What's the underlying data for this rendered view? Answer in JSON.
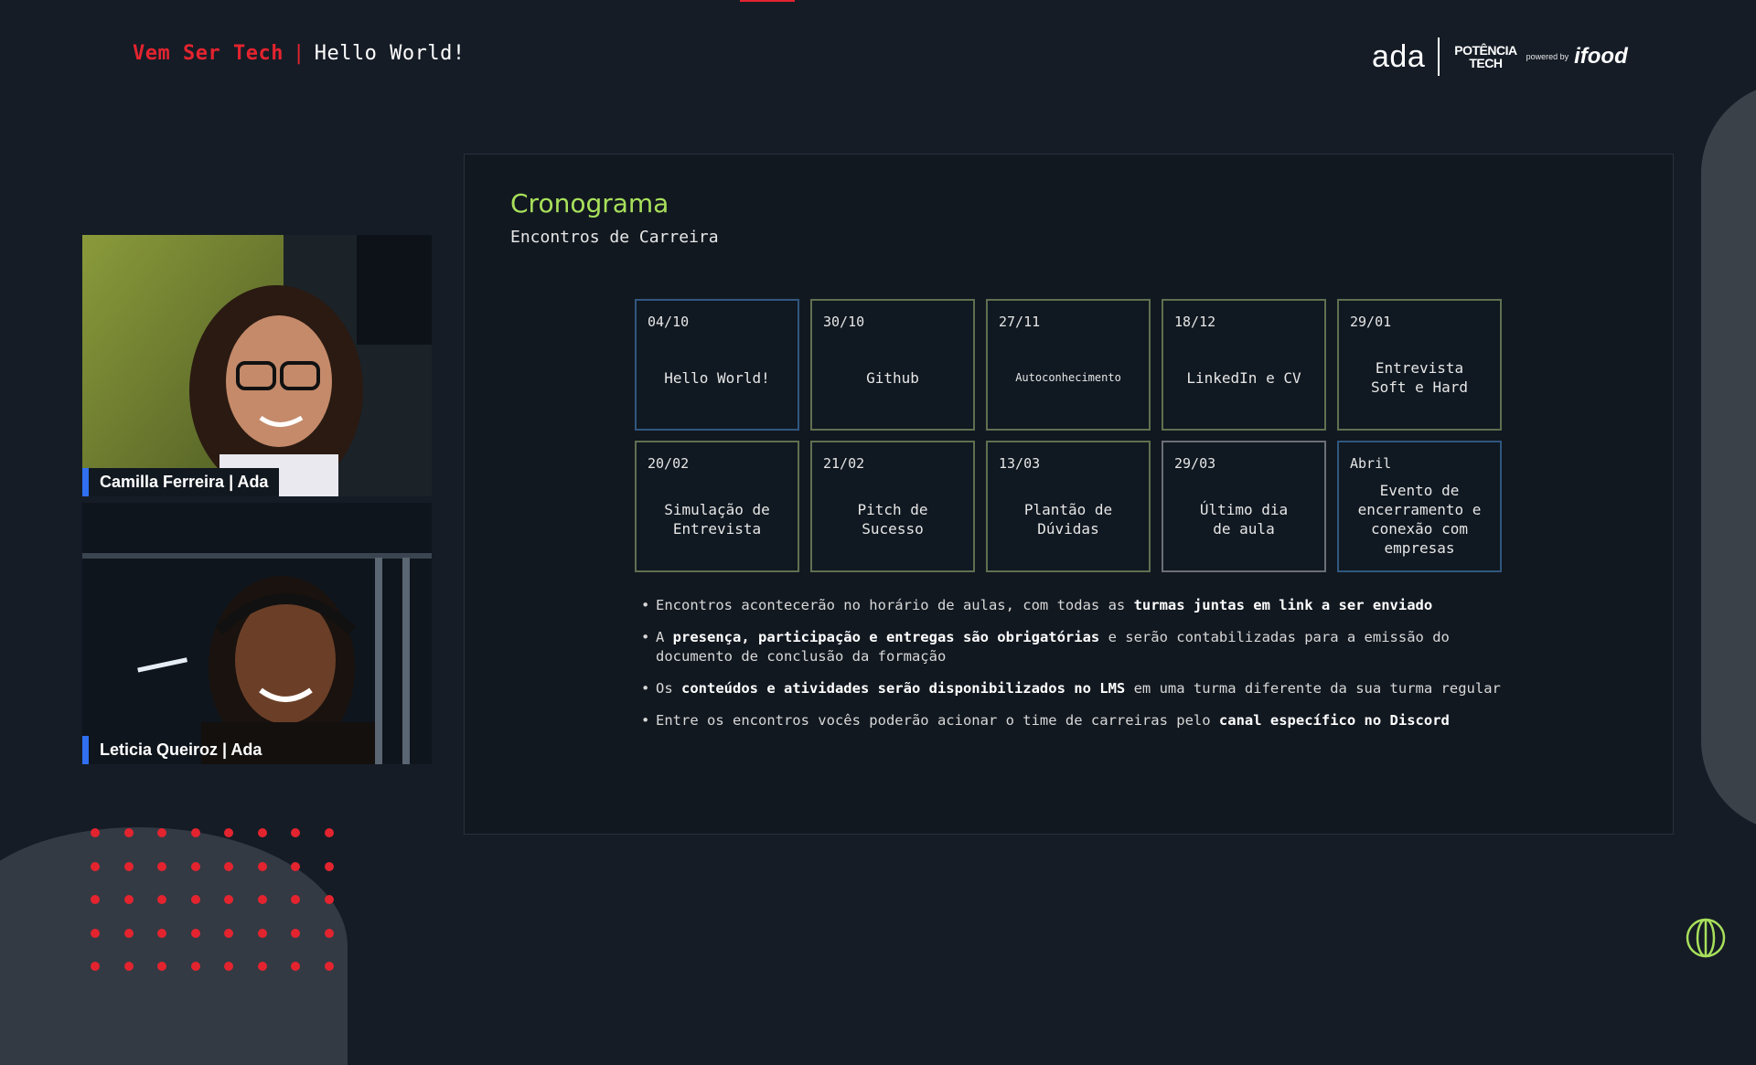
{
  "header": {
    "brand": "Vem Ser Tech",
    "separator": "|",
    "subtitle": "Hello World!"
  },
  "logos": {
    "ada": "ada",
    "potencia_line1": "POTÊNCIA",
    "potencia_line2": "TECH",
    "powered_by": "powered by",
    "ifood": "ifood"
  },
  "participants": [
    {
      "name": "Camilla Ferreira | Ada"
    },
    {
      "name": "Leticia Queiroz | Ada"
    }
  ],
  "slide": {
    "title": "Cronograma",
    "subtitle": "Encontros de Carreira",
    "events": [
      {
        "date": "04/10",
        "name": "Hello World!"
      },
      {
        "date": "30/10",
        "name": "Github"
      },
      {
        "date": "27/11",
        "name": "Autoconhecimento"
      },
      {
        "date": "18/12",
        "name": "LinkedIn e CV"
      },
      {
        "date": "29/01",
        "name": "Entrevista\nSoft e Hard"
      },
      {
        "date": "20/02",
        "name": "Simulação de\nEntrevista"
      },
      {
        "date": "21/02",
        "name": "Pitch de\nSucesso"
      },
      {
        "date": "13/03",
        "name": "Plantão de\nDúvidas"
      },
      {
        "date": "29/03",
        "name": "Último dia\nde aula"
      },
      {
        "date": "Abril",
        "name": "Evento de\nencerramento e\nconexão com\nempresas"
      }
    ],
    "notes": [
      {
        "pre": "Encontros acontecerão no horário de aulas, com todas as ",
        "bold": "turmas juntas em link a ser enviado",
        "post": ""
      },
      {
        "pre": "A ",
        "bold": "presença, participação e entregas são obrigatórias",
        "post": " e serão contabilizadas para a emissão do documento de conclusão da formação"
      },
      {
        "pre": "Os ",
        "bold": "conteúdos e atividades serão disponibilizados no LMS",
        "post": " em uma turma diferente da sua turma regular"
      },
      {
        "pre": "Entre os encontros vocês poderão acionar o time de carreiras pelo ",
        "bold": "canal específico no Discord",
        "post": ""
      }
    ]
  },
  "colors": {
    "accent_red": "#e3242f",
    "title_green": "#a8e05b",
    "card_border_green": "#5f7050",
    "card_border_blue": "#30577f",
    "name_tag_blue": "#2f6ff0",
    "background": "#151c26"
  },
  "icons": {
    "corner": "potencia-tech-globe-icon"
  }
}
